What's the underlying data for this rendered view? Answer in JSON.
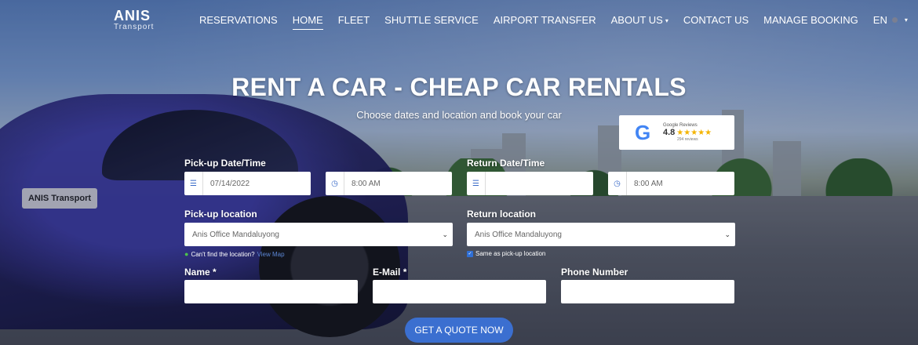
{
  "brand": {
    "name": "ANIS",
    "sub": "Transport"
  },
  "nav": {
    "items": [
      {
        "label": "RESERVATIONS"
      },
      {
        "label": "HOME",
        "active": true
      },
      {
        "label": "FLEET"
      },
      {
        "label": "SHUTTLE SERVICE"
      },
      {
        "label": "AIRPORT TRANSFER"
      },
      {
        "label": "ABOUT US",
        "dropdown": true
      },
      {
        "label": "CONTACT US"
      },
      {
        "label": "MANAGE BOOKING"
      }
    ],
    "language": "EN"
  },
  "hero": {
    "title": "RENT A CAR - CHEAP CAR RENTALS",
    "subtitle": "Choose dates and location and book your car"
  },
  "car_plate": "ANIS Transport",
  "reviews": {
    "label": "Google Reviews",
    "score": "4.8",
    "stars": "★★★★★",
    "count": "294 reviews",
    "icon": "google-g-icon"
  },
  "form": {
    "pickup_datetime_label": "Pick-up Date/Time",
    "pickup_date": "07/14/2022",
    "pickup_time": "8:00 AM",
    "return_datetime_label": "Return Date/Time",
    "return_date": "",
    "return_time": "8:00 AM",
    "pickup_location_label": "Pick-up location",
    "pickup_location": "Anis Office Mandaluyong",
    "return_location_label": "Return location",
    "return_location": "Anis Office Mandaluyong",
    "cant_find": "Can't find the location?",
    "view_map": "View Map",
    "same_as_pickup": "Same as pick-up location",
    "name_label": "Name",
    "email_label": "E-Mail",
    "phone_label": "Phone Number",
    "required_mark": "*",
    "submit": "GET A QUOTE NOW"
  },
  "colors": {
    "accent": "#3b6fd0",
    "star": "#f4b400",
    "pin": "#4cc34c"
  }
}
